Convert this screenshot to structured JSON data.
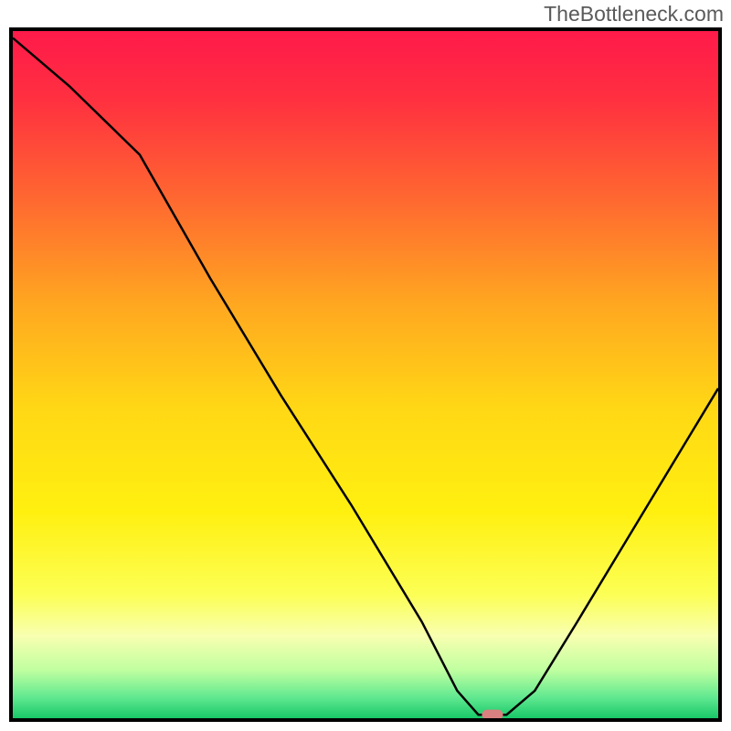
{
  "watermark": "TheBottleneck.com",
  "chart_data": {
    "type": "line",
    "title": "",
    "xlabel": "",
    "ylabel": "",
    "xlim": [
      0,
      100
    ],
    "ylim": [
      0,
      100
    ],
    "x": [
      0,
      8,
      18,
      28,
      38,
      48,
      58,
      63,
      66,
      70,
      74,
      80,
      90,
      100
    ],
    "values": [
      99,
      92,
      82,
      64,
      47,
      31,
      14,
      4,
      0.5,
      0.5,
      4,
      14,
      31,
      48
    ],
    "curve_color": "#000000",
    "curve_width": 2.5,
    "marker": {
      "x": 68,
      "y": 0.5,
      "color": "#d98080",
      "width": 3,
      "height": 1.5
    },
    "background_gradient": {
      "stops": [
        {
          "offset": 0,
          "color": "#ff1a4a"
        },
        {
          "offset": 0.1,
          "color": "#ff3040"
        },
        {
          "offset": 0.25,
          "color": "#ff6a30"
        },
        {
          "offset": 0.4,
          "color": "#ffa820"
        },
        {
          "offset": 0.55,
          "color": "#ffd815"
        },
        {
          "offset": 0.7,
          "color": "#fff010"
        },
        {
          "offset": 0.82,
          "color": "#fcff55"
        },
        {
          "offset": 0.88,
          "color": "#f8ffb0"
        },
        {
          "offset": 0.93,
          "color": "#c0ffa0"
        },
        {
          "offset": 0.97,
          "color": "#60e890"
        },
        {
          "offset": 1.0,
          "color": "#18c868"
        }
      ]
    }
  }
}
